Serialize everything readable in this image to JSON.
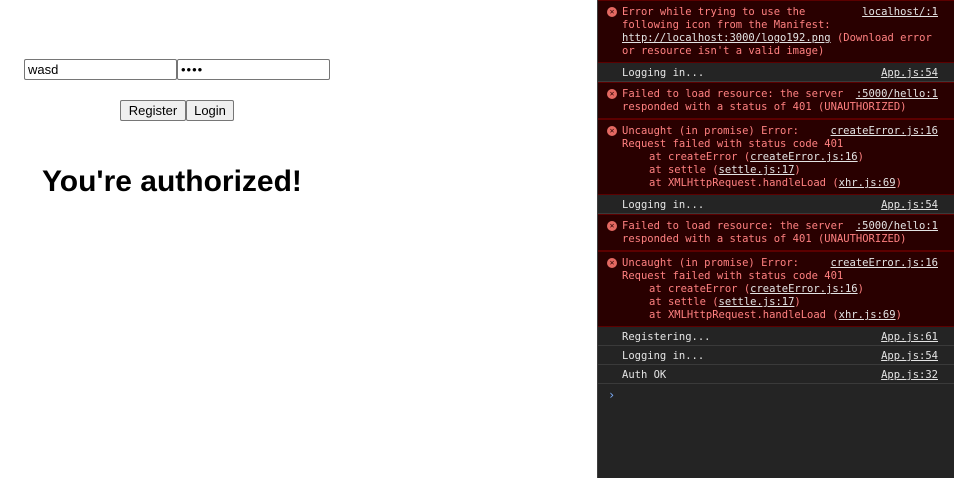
{
  "app": {
    "username_value": "wasd",
    "password_value": "••••",
    "register_label": "Register",
    "login_label": "Login",
    "status_message": "You're authorized!"
  },
  "console": {
    "error_icon": "error-circle-icon",
    "prompt_icon": "chevron-right-icon",
    "prompt_glyph": "›",
    "colors": {
      "background": "#242424",
      "error_background": "#290000",
      "error_text": "#ff8080",
      "log_text": "#e3e3e3"
    },
    "messages": [
      {
        "line1": "Error while trying to use the",
        "source": "localhost/:1",
        "line2": "following icon from the Manifest:",
        "url": "http://localhost:3000/logo192.png",
        "line3": "(Download error or resource isn't a valid image)"
      },
      {
        "text": "Logging in...",
        "source": "App.js:54"
      },
      {
        "line1": "Failed to load resource: the",
        "source": ":5000/hello:1",
        "line2": "server responded with a status of 401",
        "line3": "(UNAUTHORIZED)"
      },
      {
        "line1": "Uncaught (in promise) Error:",
        "source": "createError.js:16",
        "line2": "Request failed with status code 401",
        "stack": [
          {
            "prefix": "at createError (",
            "file": "createError.js:16",
            "suffix": ")"
          },
          {
            "prefix": "at settle (",
            "file": "settle.js:17",
            "suffix": ")"
          },
          {
            "prefix": "at XMLHttpRequest.handleLoad (",
            "file": "xhr.js:69",
            "suffix": ")"
          }
        ]
      },
      {
        "text": "Logging in...",
        "source": "App.js:54"
      },
      {
        "line1": "Failed to load resource: the",
        "source": ":5000/hello:1",
        "line2": "server responded with a status of 401",
        "line3": "(UNAUTHORIZED)"
      },
      {
        "line1": "Uncaught (in promise) Error:",
        "source": "createError.js:16",
        "line2": "Request failed with status code 401",
        "stack": [
          {
            "prefix": "at createError (",
            "file": "createError.js:16",
            "suffix": ")"
          },
          {
            "prefix": "at settle (",
            "file": "settle.js:17",
            "suffix": ")"
          },
          {
            "prefix": "at XMLHttpRequest.handleLoad (",
            "file": "xhr.js:69",
            "suffix": ")"
          }
        ]
      },
      {
        "text": "Registering...",
        "source": "App.js:61"
      },
      {
        "text": "Logging in...",
        "source": "App.js:54"
      },
      {
        "text": "Auth OK",
        "source": "App.js:32"
      }
    ]
  }
}
